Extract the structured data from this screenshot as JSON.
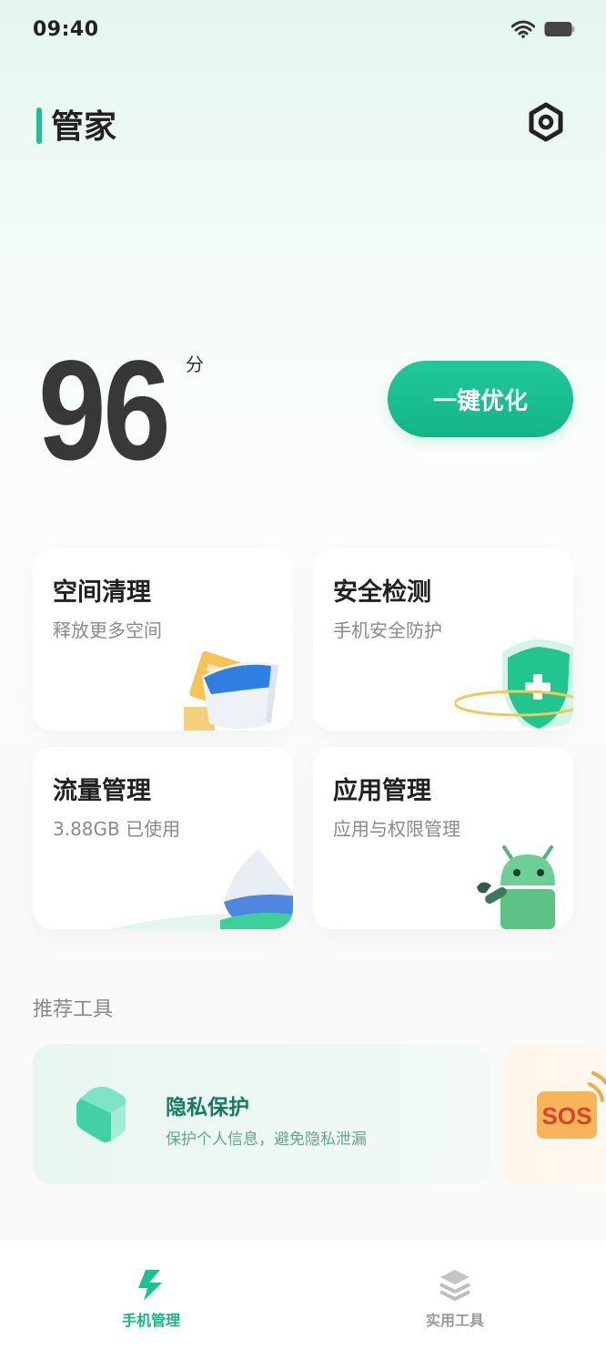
{
  "status_bar": {
    "time": "09:40"
  },
  "header": {
    "title": "管家",
    "settings_icon": "gear-icon"
  },
  "score": {
    "value": "96",
    "unit": "分"
  },
  "optimize_button": {
    "label": "一键优化"
  },
  "cards": [
    {
      "title": "空间清理",
      "subtitle": "释放更多空间",
      "icon": "cleanup-bucket-icon"
    },
    {
      "title": "安全检测",
      "subtitle": "手机安全防护",
      "icon": "shield-icon"
    },
    {
      "title": "流量管理",
      "subtitle": "3.88GB 已使用",
      "icon": "water-drop-icon"
    },
    {
      "title": "应用管理",
      "subtitle": "应用与权限管理",
      "icon": "android-wrench-icon"
    }
  ],
  "recommended": {
    "section_title": "推荐工具",
    "tools": [
      {
        "title": "隐私保护",
        "subtitle": "保护个人信息，避免隐私泄漏",
        "icon": "privacy-cube-icon"
      },
      {
        "title": "SOS",
        "icon": "sos-icon"
      }
    ]
  },
  "bottom_nav": [
    {
      "label": "手机管理",
      "icon": "lightning-icon",
      "active": true
    },
    {
      "label": "实用工具",
      "icon": "layers-icon",
      "active": false
    }
  ],
  "colors": {
    "accent": "#1bc392",
    "text": "#222222",
    "subtle": "#8a8a8a",
    "background": "#fafafa"
  }
}
